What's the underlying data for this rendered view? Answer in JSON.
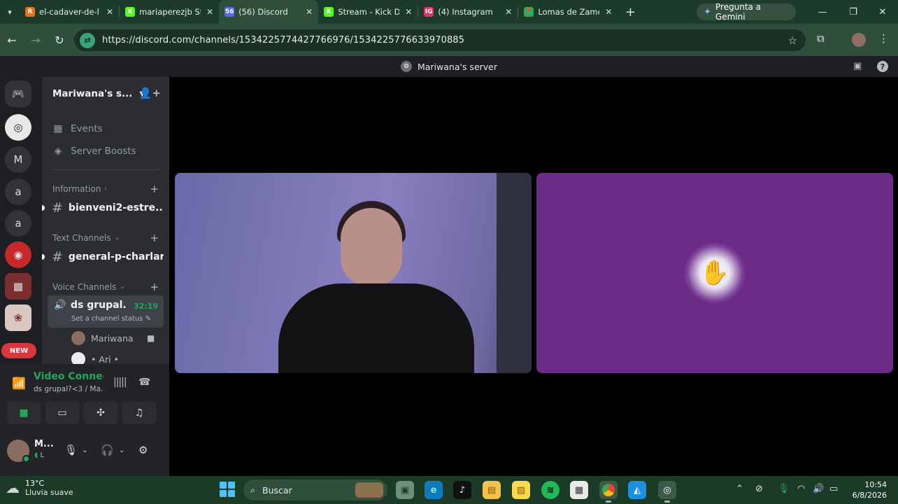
{
  "browser": {
    "tabs": [
      {
        "title": "el-cadaver-de-l",
        "favicon": "R",
        "color": "#e8711a",
        "active": false
      },
      {
        "title": "mariaperezjb St",
        "favicon": "K",
        "color": "#53fc18",
        "active": false
      },
      {
        "title": "(56) Discord",
        "favicon": "56",
        "color": "#5865f2",
        "active": true
      },
      {
        "title": "Stream - Kick D",
        "favicon": "K",
        "color": "#53fc18",
        "active": false
      },
      {
        "title": "(4) Instagram",
        "favicon": "IG",
        "color": "#e1306c",
        "active": false
      },
      {
        "title": "Lomas de Zamo",
        "favicon": "📍",
        "color": "#34a853",
        "active": false
      }
    ],
    "gemini_label": "Pregunta a Gemini",
    "url": "https://discord.com/channels/1534225774427766976/1534225776633970885"
  },
  "discord": {
    "window_title": "Mariwana's server",
    "server_name": "Mariwana's s...",
    "menu": {
      "events": "Events",
      "boosts": "Server Boosts"
    },
    "categories": {
      "information": "Information",
      "text": "Text Channels",
      "voice": "Voice Channels"
    },
    "channels": {
      "info_channel": "bienveni2-estre...",
      "text_channel": "general-p-charlar"
    },
    "voice_channel": {
      "name": "ds grupal...",
      "timer": "32:19",
      "status": "Set a channel status"
    },
    "voice_users": [
      {
        "name": "Mariwana",
        "camera": true
      },
      {
        "name": "• Ari •",
        "camera": false
      }
    ],
    "rail": {
      "letter_m": "M",
      "letter_a1": "a",
      "letter_a2": "a",
      "new_badge": "NEW"
    },
    "rtc": {
      "title": "Video Connected",
      "subtitle": "ds grupal?<3 / Ma..."
    },
    "user": {
      "name": "M...",
      "status": "L"
    }
  },
  "taskbar": {
    "weather_temp": "13°C",
    "weather_desc": "Lluvia suave",
    "search_label": "Buscar",
    "time": "10:54",
    "date": "6/8/2026"
  },
  "colors": {
    "accent_green": "#23a55a",
    "discord_dark": "#1e1f22",
    "tile_purple": "#6d2a86"
  }
}
